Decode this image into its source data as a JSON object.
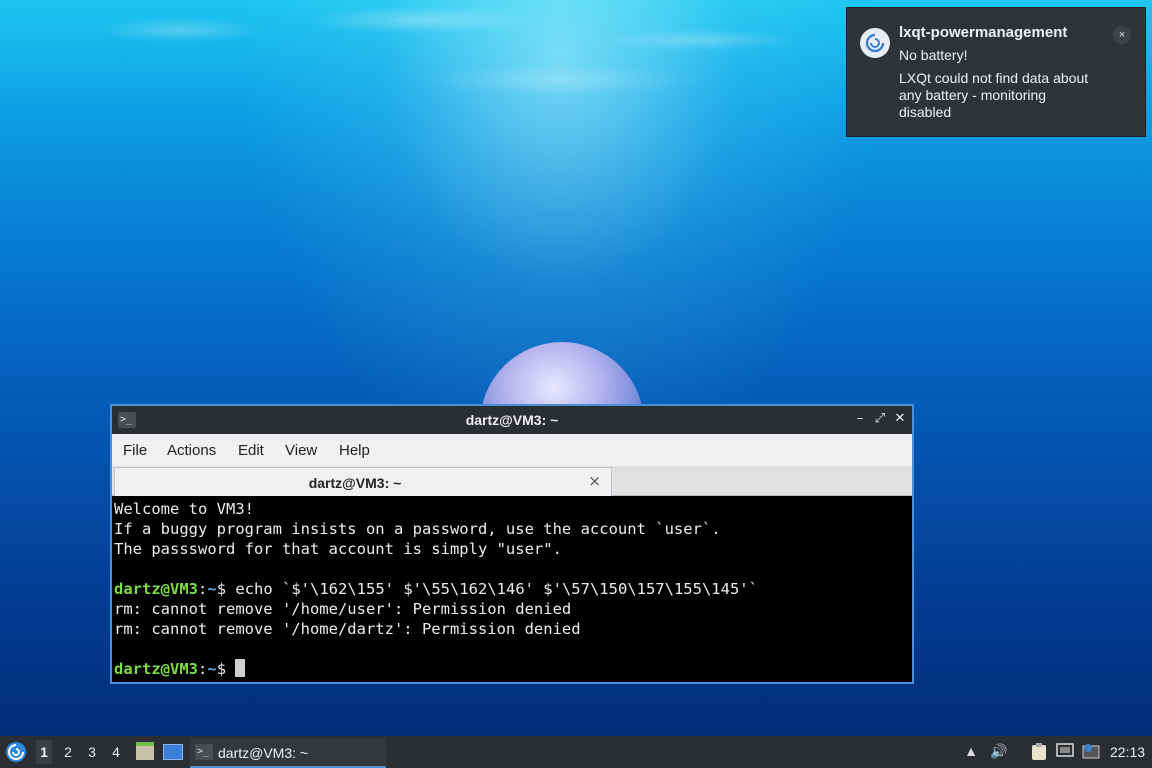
{
  "notification": {
    "app": "lxqt-powermanagement",
    "summary": "No battery!",
    "body": "LXQt could not find data about any battery - monitoring disabled",
    "close": "×"
  },
  "terminal_window": {
    "title": "dartz@VM3: ~",
    "menu": [
      "File",
      "Actions",
      "Edit",
      "View",
      "Help"
    ],
    "tab_label": "dartz@VM3: ~",
    "tab_close": "×",
    "lines": {
      "l1": "Welcome to VM3!",
      "l2": "If a buggy program insists on a password, use the account `user`.",
      "l3": "The passsword for that account is simply \"user\".",
      "prompt_user": "dartz@VM3",
      "prompt_sep": ":",
      "prompt_path": "~",
      "prompt_dollar": "$ ",
      "command": "echo `$'\\162\\155' $'\\55\\162\\146' $'\\57\\150\\157\\155\\145'`",
      "out1": "rm: cannot remove '/home/user': Permission denied",
      "out2": "rm: cannot remove '/home/dartz': Permission denied"
    }
  },
  "taskbar": {
    "workspaces": [
      "1",
      "2",
      "3",
      "4"
    ],
    "active_workspace": "1",
    "task_label": "dartz@VM3: ~",
    "clock": "22:13"
  }
}
